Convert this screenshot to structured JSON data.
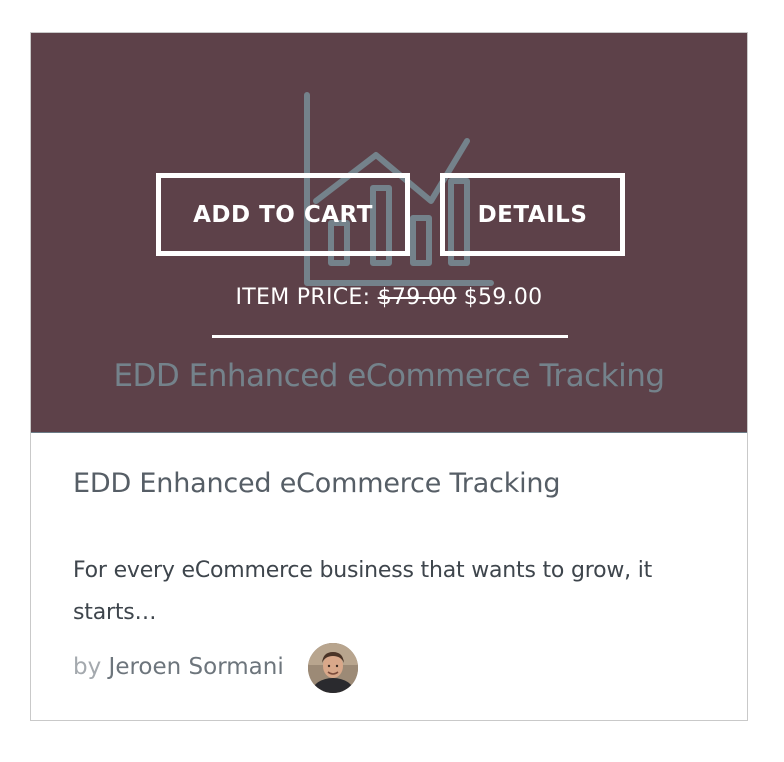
{
  "product": {
    "image_watermark": "EDD Enhanced eCommerce Tracking",
    "add_to_cart_label": "ADD TO CART",
    "details_label": "DETAILS",
    "price_label": "ITEM PRICE:",
    "old_price": "$79.00",
    "new_price": "$59.00",
    "title": "EDD Enhanced eCommerce Tracking",
    "excerpt": "For every eCommerce business that wants to grow, it starts…",
    "by_label": "by",
    "author": "Jeroen Sormani"
  },
  "colors": {
    "hero_background": "#5d4149",
    "button_border": "#ffffff",
    "title_text": "#565e66",
    "byline_by": "#a4a9ae"
  },
  "icons": {
    "hero_art": "chart-house-icon",
    "avatar": "author-avatar"
  }
}
